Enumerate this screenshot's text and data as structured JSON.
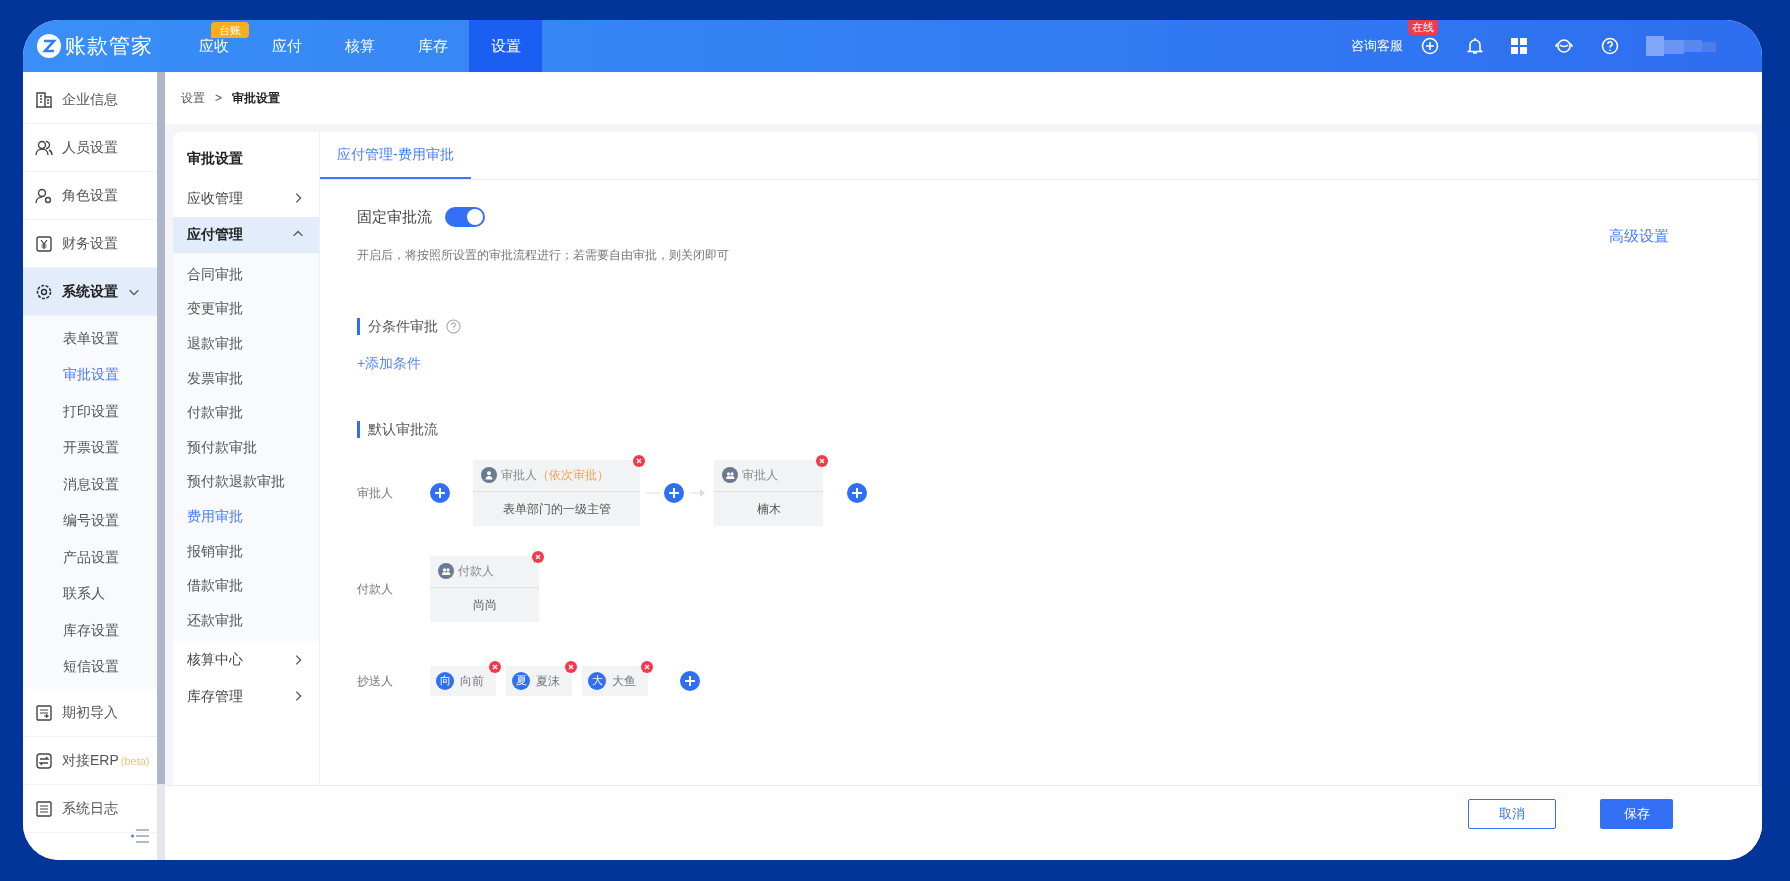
{
  "top_nav": {
    "logo": "账款管家",
    "tabs": [
      {
        "label": "应收",
        "selected": false,
        "badge": "台账"
      },
      {
        "label": "应付",
        "selected": false
      },
      {
        "label": "核算",
        "selected": false
      },
      {
        "label": "库存",
        "selected": false
      },
      {
        "label": "设置",
        "selected": true
      }
    ],
    "support": "咨询客服",
    "support_badge": "在线"
  },
  "breadcrumb": {
    "items": [
      "设置",
      "审批设置"
    ],
    "separator": ">"
  },
  "sidebar": {
    "items": [
      {
        "label": "企业信息",
        "selected": false
      },
      {
        "label": "人员设置",
        "selected": false
      },
      {
        "label": "角色设置",
        "selected": false
      },
      {
        "label": "财务设置",
        "selected": false
      },
      {
        "label": "系统设置",
        "selected": true,
        "expanded": true,
        "children": [
          {
            "label": "表单设置",
            "selected": false
          },
          {
            "label": "审批设置",
            "selected": true
          },
          {
            "label": "打印设置",
            "selected": false
          },
          {
            "label": "开票设置",
            "selected": false
          },
          {
            "label": "消息设置",
            "selected": false
          },
          {
            "label": "编号设置",
            "selected": false
          },
          {
            "label": "产品设置",
            "selected": false
          },
          {
            "label": "联系人",
            "selected": false
          },
          {
            "label": "库存设置",
            "selected": false
          },
          {
            "label": "短信设置",
            "selected": false
          }
        ]
      },
      {
        "label": "期初导入",
        "selected": false
      },
      {
        "label": "对接ERP",
        "suffix": "(beta)",
        "selected": false
      },
      {
        "label": "系统日志",
        "selected": false
      }
    ]
  },
  "sub_menu": {
    "title": "审批设置",
    "groups": [
      {
        "label": "应收管理",
        "expanded": false
      },
      {
        "label": "应付管理",
        "expanded": true,
        "children": [
          {
            "label": "合同审批",
            "selected": false
          },
          {
            "label": "变更审批",
            "selected": false
          },
          {
            "label": "退款审批",
            "selected": false
          },
          {
            "label": "发票审批",
            "selected": false
          },
          {
            "label": "付款审批",
            "selected": false
          },
          {
            "label": "预付款审批",
            "selected": false
          },
          {
            "label": "预付款退款审批",
            "selected": false
          },
          {
            "label": "费用审批",
            "selected": true
          },
          {
            "label": "报销审批",
            "selected": false
          },
          {
            "label": "借款审批",
            "selected": false
          },
          {
            "label": "还款审批",
            "selected": false
          }
        ]
      },
      {
        "label": "核算中心",
        "expanded": false
      },
      {
        "label": "库存管理",
        "expanded": false
      }
    ]
  },
  "content": {
    "tabs": [
      {
        "label": "应付管理-费用审批",
        "selected": true
      }
    ],
    "fixed_flow": {
      "label": "固定审批流",
      "on": true,
      "hint": "开启后，将按照所设置的审批流程进行；若需要自由审批，则关闭即可"
    },
    "advanced_link": "高级设置",
    "condition_section": {
      "title": "分条件审批",
      "add_link": "+添加条件"
    },
    "default_section": {
      "title": "默认审批流",
      "rows": [
        {
          "kind": "approvers",
          "label": "审批人",
          "nodes": [
            {
              "title": "审批人",
              "note": "（依次审批）",
              "value": "表单部门的一级主管"
            },
            {
              "title": "审批人",
              "value": "楠木"
            }
          ]
        },
        {
          "kind": "payer",
          "label": "付款人",
          "nodes": [
            {
              "title": "付款人",
              "value": "尚尚"
            }
          ]
        },
        {
          "kind": "cc",
          "label": "抄送人",
          "chips": [
            {
              "avatar": "向",
              "name": "向前"
            },
            {
              "avatar": "夏",
              "name": "夏沫"
            },
            {
              "avatar": "大",
              "name": "大鱼"
            }
          ]
        }
      ]
    }
  },
  "footer": {
    "buttons": [
      {
        "kind": "secondary",
        "label": "取消"
      },
      {
        "kind": "primary",
        "label": "保存"
      }
    ]
  }
}
